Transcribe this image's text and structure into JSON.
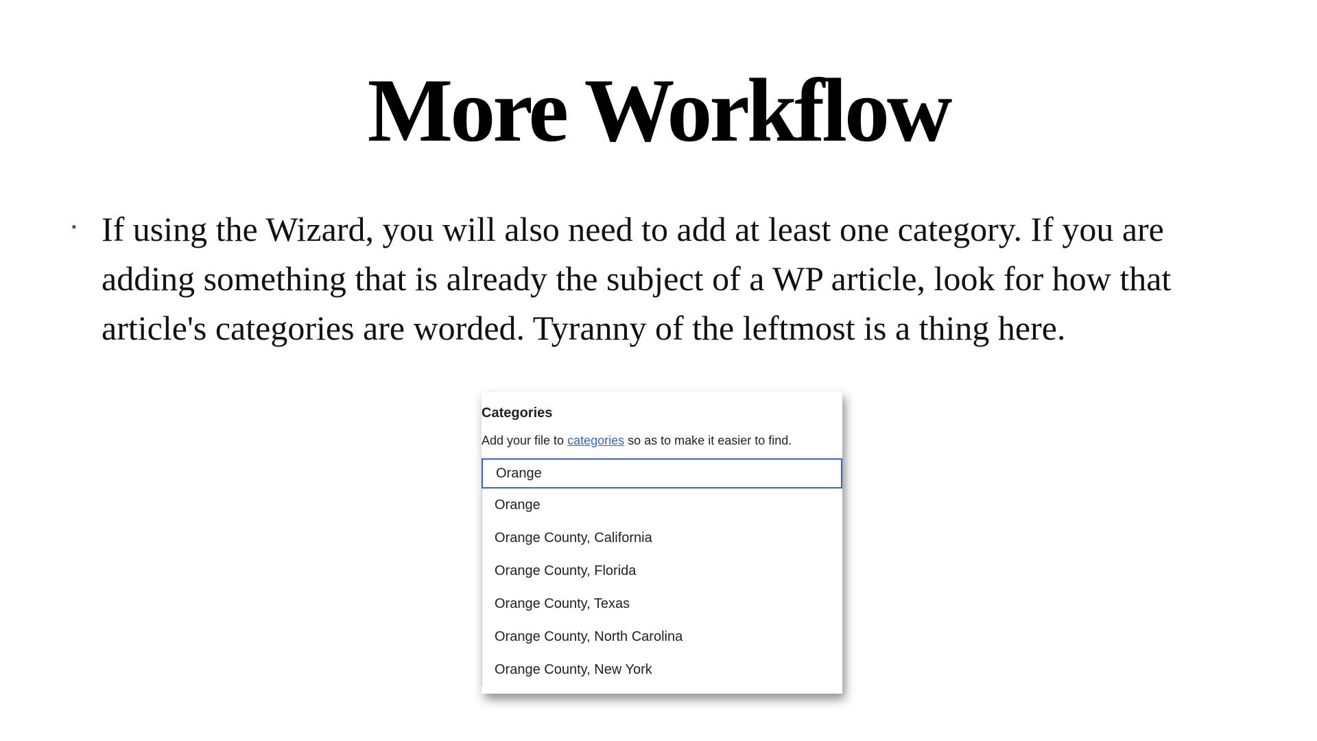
{
  "slide": {
    "title": "More Workflow",
    "bullets": [
      "If using the Wizard, you will also need to add at least one category. If you are adding something that is already the subject of a WP article, look for how that article's categories are worded. Tyranny of the leftmost is a thing here."
    ],
    "bullet_glyph": "•",
    "accent_color": "#7a2f8e"
  },
  "categories_widget": {
    "heading": "Categories",
    "help_prefix": "Add your file to ",
    "help_link": "categories",
    "help_suffix": " so as to make it easier to find.",
    "input_value": "Orange",
    "suggestions": [
      "Orange",
      "Orange County, California",
      "Orange County, Florida",
      "Orange County, Texas",
      "Orange County, North Carolina",
      "Orange County, New York"
    ],
    "link_color": "#3366cc",
    "focus_border_color": "#3366cc"
  }
}
